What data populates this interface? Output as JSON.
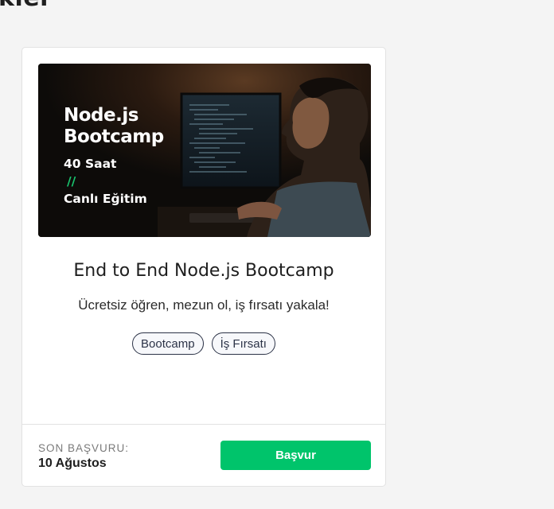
{
  "section": {
    "title": "kler"
  },
  "card": {
    "banner": {
      "line1": "Node.js",
      "line2": "Bootcamp",
      "hours": "40 Saat",
      "slashes": "//",
      "mode": "Canlı Eğitim"
    },
    "title": "End to End Node.js Bootcamp",
    "description": "Ücretsiz öğren, mezun ol, iş fırsatı yakala!",
    "tags": [
      "Bootcamp",
      "İş Fırsatı"
    ],
    "deadline_label": "SON BAŞVURU:",
    "deadline_value": "10 Ağustos",
    "apply_label": "Başvur"
  },
  "colors": {
    "accent": "#00c46b",
    "tag_border": "#2c3347",
    "banner_slashes": "#19c46e"
  },
  "icons": {
    "banner_image": "man-at-computer-image"
  }
}
